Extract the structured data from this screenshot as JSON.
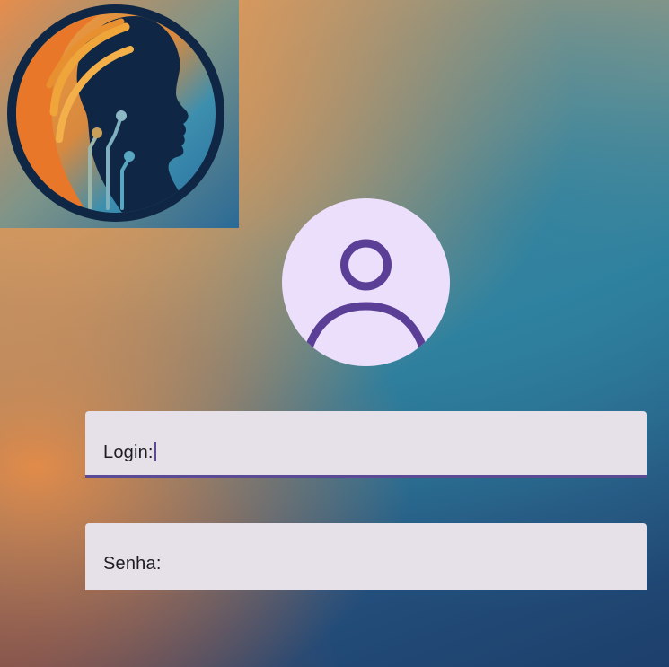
{
  "logo": {
    "icon": "woman-profile-circuit-logo",
    "colors": {
      "ring": "#0f2744",
      "orange": "#e87a2a",
      "gold": "#f2a03a",
      "teal": "#4aa3b8"
    }
  },
  "avatar": {
    "icon": "person-icon",
    "background": "#ebdffb",
    "stroke": "#5b3e96"
  },
  "form": {
    "login_label": "Login:",
    "senha_label": "Senha:",
    "active_field": "login",
    "accent": "#5b4a96"
  }
}
